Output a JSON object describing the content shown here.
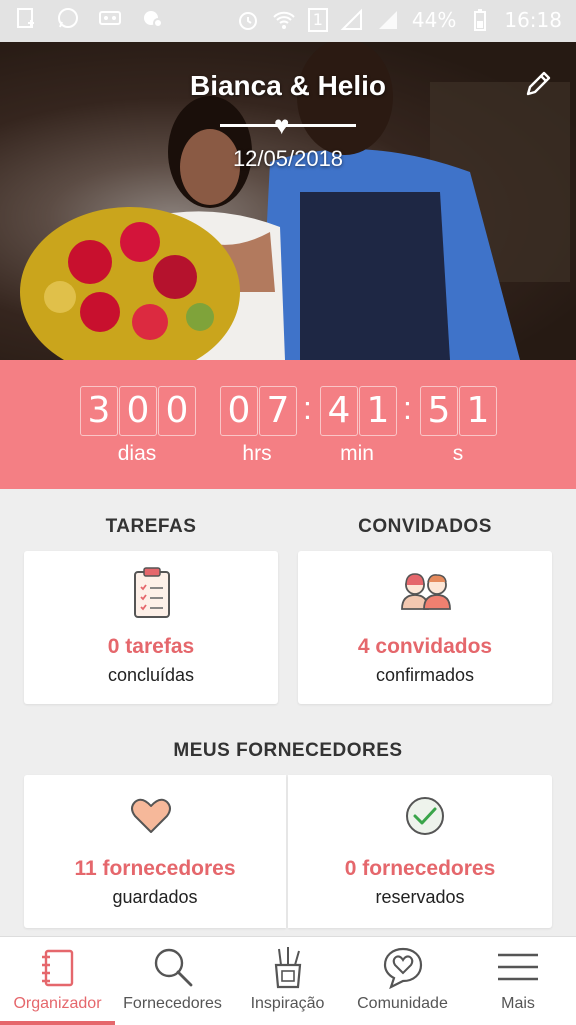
{
  "status_bar": {
    "battery": "44%",
    "time": "16:18",
    "sim": "1"
  },
  "hero": {
    "couple": "Bianca & Helio",
    "date": "12/05/2018"
  },
  "countdown": {
    "days_digits": [
      "3",
      "0",
      "0"
    ],
    "hours_digits": [
      "0",
      "7"
    ],
    "minutes_digits": [
      "4",
      "1"
    ],
    "seconds_digits": [
      "5",
      "1"
    ],
    "labels": {
      "days": "dias",
      "hours": "hrs",
      "minutes": "min",
      "seconds": "s"
    }
  },
  "tasks": {
    "title": "TAREFAS",
    "count_text": "0 tarefas",
    "subtitle": "concluídas"
  },
  "guests": {
    "title": "CONVIDADOS",
    "count_text": "4 convidados",
    "subtitle": "confirmados"
  },
  "suppliers": {
    "title": "MEUS FORNECEDORES",
    "saved_text": "11 fornecedores",
    "saved_subtitle": "guardados",
    "reserved_text": "0 fornecedores",
    "reserved_subtitle": "reservados"
  },
  "bottom_nav": {
    "items": [
      {
        "label": "Organizador",
        "icon": "notebook-icon"
      },
      {
        "label": "Fornecedores",
        "icon": "search-icon"
      },
      {
        "label": "Inspiração",
        "icon": "inspiration-cup-icon"
      },
      {
        "label": "Comunidade",
        "icon": "chat-heart-icon"
      },
      {
        "label": "Mais",
        "icon": "hamburger-menu-icon"
      }
    ],
    "active": "Organizador"
  },
  "colors": {
    "accent": "#e5676c",
    "countdown_bg": "#f47f84"
  }
}
